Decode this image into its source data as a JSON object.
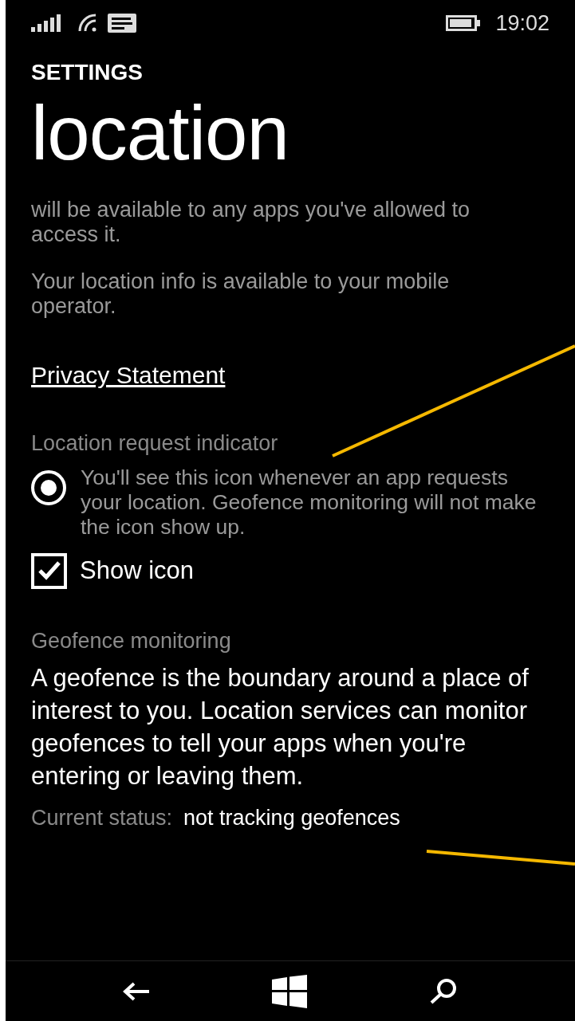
{
  "status_bar": {
    "time": "19:02"
  },
  "header": {
    "app": "SETTINGS",
    "title": "location"
  },
  "intro": [
    "will be available to any apps you've allowed to access it.",
    "Your location info is available to your mobile operator."
  ],
  "privacy_link": "Privacy Statement",
  "indicator": {
    "heading": "Location request indicator",
    "description": "You'll see this icon whenever an app requests your location. Geofence monitoring will not make the icon show up.",
    "radio_selected": true,
    "checkbox": {
      "label": "Show icon",
      "checked": true
    }
  },
  "geofence": {
    "heading": "Geofence monitoring",
    "description": "A geofence is the boundary around a place of interest to you. Location services can monitor geofences to tell your apps when you're entering or leaving them.",
    "status_label": "Current status:",
    "status_value": "not tracking geofences"
  }
}
